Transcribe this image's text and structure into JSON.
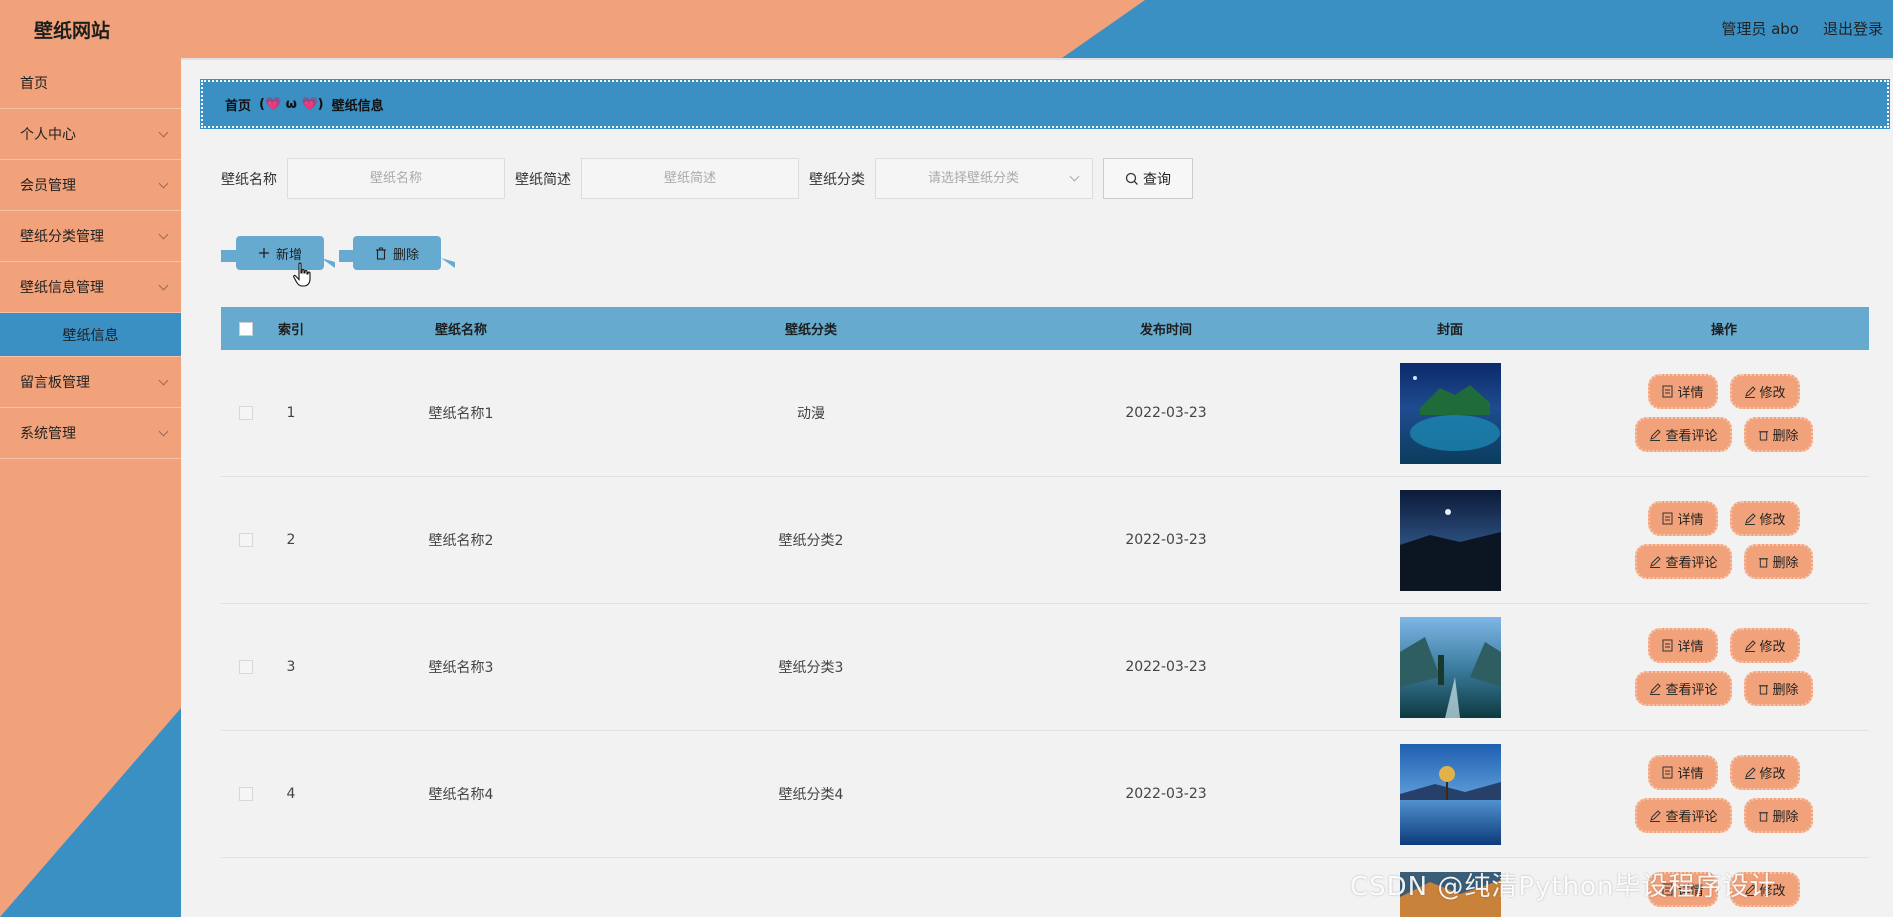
{
  "header": {
    "brand": "壁纸网站",
    "user": "管理员 abo",
    "logout": "退出登录"
  },
  "sidebar": {
    "items": [
      {
        "label": "首页"
      },
      {
        "label": "个人中心"
      },
      {
        "label": "会员管理"
      },
      {
        "label": "壁纸分类管理"
      },
      {
        "label": "壁纸信息管理"
      }
    ],
    "active_sub": "壁纸信息",
    "items_after": [
      {
        "label": "留言板管理"
      },
      {
        "label": "系统管理"
      }
    ]
  },
  "breadcrumb": {
    "home": "首页",
    "sep": "(💗 ω 💗)",
    "current": "壁纸信息"
  },
  "search": {
    "name_label": "壁纸名称",
    "name_placeholder": "壁纸名称",
    "desc_label": "壁纸简述",
    "desc_placeholder": "壁纸简述",
    "cat_label": "壁纸分类",
    "cat_placeholder": "请选择壁纸分类",
    "query_label": "查询"
  },
  "actions": {
    "add_label": "新增",
    "delete_label": "删除"
  },
  "table": {
    "headers": [
      "索引",
      "壁纸名称",
      "壁纸分类",
      "发布时间",
      "封面",
      "操作"
    ],
    "rows": [
      {
        "index": "1",
        "name": "壁纸名称1",
        "category": "动漫",
        "date": "2022-03-23"
      },
      {
        "index": "2",
        "name": "壁纸名称2",
        "category": "壁纸分类2",
        "date": "2022-03-23"
      },
      {
        "index": "3",
        "name": "壁纸名称3",
        "category": "壁纸分类3",
        "date": "2022-03-23"
      },
      {
        "index": "4",
        "name": "壁纸名称4",
        "category": "壁纸分类4",
        "date": "2022-03-23"
      }
    ],
    "ops": {
      "detail": "详情",
      "edit": "修改",
      "comments": "查看评论",
      "delete": "删除"
    }
  },
  "watermark": "CSDN @纯清Python毕设程序设计",
  "colors": {
    "orange": "#f2a27a",
    "blue": "#3a8fc3",
    "light_blue": "#66aad0"
  }
}
